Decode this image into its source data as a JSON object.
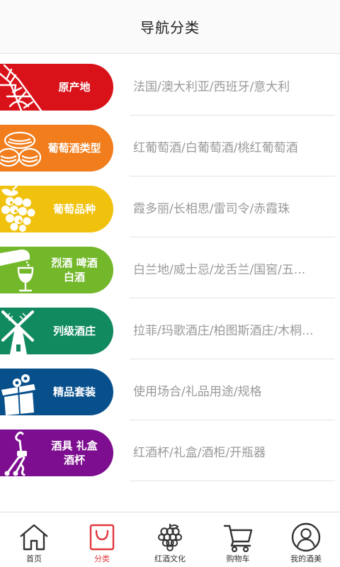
{
  "header": {
    "title": "导航分类"
  },
  "categories": [
    {
      "label": "原产地",
      "desc": "法国/澳大利亚/西班牙/意大利",
      "color": "#d9121a",
      "icon": "eiffel-tower-icon"
    },
    {
      "label": "葡萄酒类型",
      "desc": "红葡萄酒/白葡萄酒/桃红葡萄酒",
      "color": "#f17d1c",
      "icon": "wine-barrels-icon"
    },
    {
      "label": "葡萄品种",
      "desc": "霞多丽/长相思/雷司令/赤霞珠",
      "color": "#f0c20e",
      "icon": "grapes-icon"
    },
    {
      "label": "烈酒  啤酒\n白酒",
      "desc": "白兰地/威士忌/龙舌兰/国窖/五...",
      "color": "#73b72a",
      "icon": "bottle-glass-icon"
    },
    {
      "label": "列级酒庄",
      "desc": "拉菲/玛歌酒庄/柏图斯酒庄/木桐...",
      "color": "#118a5f",
      "icon": "windmill-icon"
    },
    {
      "label": "精品套装",
      "desc": "使用场合/礼品用途/规格",
      "color": "#08508c",
      "icon": "gift-box-icon"
    },
    {
      "label": "酒具  礼盒\n酒杯",
      "desc": "红酒杯/礼盒/酒柜/开瓶器",
      "color": "#7d0e8f",
      "icon": "corkscrew-icon"
    }
  ],
  "tabbar": {
    "accent_color": "#e0383e",
    "items": [
      {
        "label": "首页",
        "icon": "home-icon",
        "active": false
      },
      {
        "label": "分类",
        "icon": "shopping-bag-icon",
        "active": true
      },
      {
        "label": "红酒文化",
        "icon": "grape-bunch-icon",
        "active": false
      },
      {
        "label": "购物车",
        "icon": "cart-icon",
        "active": false
      },
      {
        "label": "我的酒美",
        "icon": "user-icon",
        "active": false
      }
    ]
  }
}
